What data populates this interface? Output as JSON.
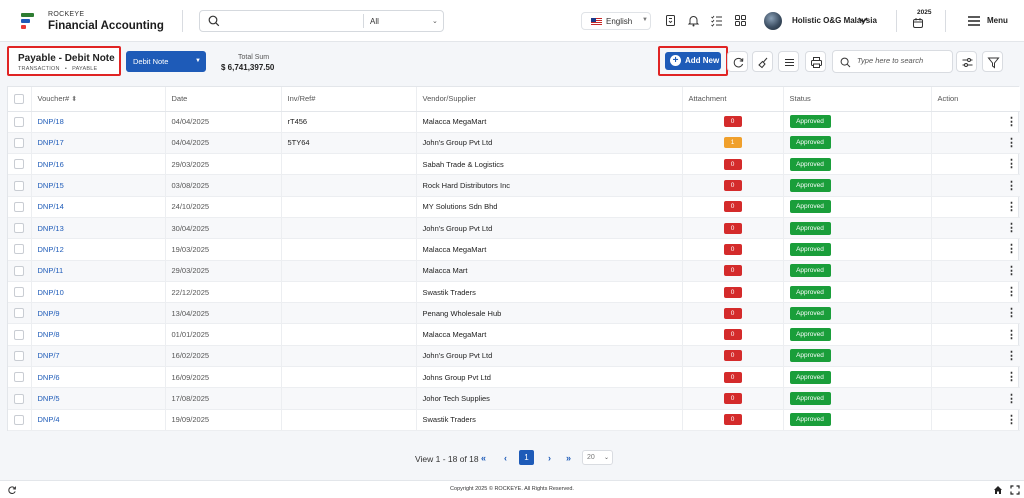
{
  "brand": {
    "small": "ROCKEYE",
    "name": "Financial Accounting"
  },
  "search": {
    "placeholder": "",
    "scope": "All"
  },
  "language": {
    "label": "English"
  },
  "user": {
    "company": "Holistic O&G Malaysia",
    "year": "2025"
  },
  "menu": {
    "label": "Menu"
  },
  "page": {
    "title": "Payable - Debit Note",
    "breadcrumb": [
      "TRANSACTION",
      "PAYABLE"
    ],
    "doc_type": "Debit Note",
    "total_label": "Total Sum",
    "total_value": "$ 6,741,397.50",
    "add_label": "Add New",
    "table_search_placeholder": "Type here to search"
  },
  "table": {
    "columns": [
      "Voucher#",
      "Date",
      "Inv/Ref#",
      "Vendor/Supplier",
      "Attachment",
      "Status",
      "Action"
    ],
    "rows": [
      {
        "voucher": "DNP/18",
        "date": "04/04/2025",
        "ref": "rT456",
        "vendor": "Malacca MegaMart",
        "attachment": "0",
        "status": "Approved"
      },
      {
        "voucher": "DNP/17",
        "date": "04/04/2025",
        "ref": "5TY64",
        "vendor": "John's Group Pvt Ltd",
        "attachment": "1",
        "status": "Approved"
      },
      {
        "voucher": "DNP/16",
        "date": "29/03/2025",
        "ref": "",
        "vendor": "Sabah Trade & Logistics",
        "attachment": "0",
        "status": "Approved"
      },
      {
        "voucher": "DNP/15",
        "date": "03/08/2025",
        "ref": "",
        "vendor": "Rock Hard Distributors Inc",
        "attachment": "0",
        "status": "Approved"
      },
      {
        "voucher": "DNP/14",
        "date": "24/10/2025",
        "ref": "",
        "vendor": "MY Solutions Sdn Bhd",
        "attachment": "0",
        "status": "Approved"
      },
      {
        "voucher": "DNP/13",
        "date": "30/04/2025",
        "ref": "",
        "vendor": "John's Group Pvt Ltd",
        "attachment": "0",
        "status": "Approved"
      },
      {
        "voucher": "DNP/12",
        "date": "19/03/2025",
        "ref": "",
        "vendor": "Malacca MegaMart",
        "attachment": "0",
        "status": "Approved"
      },
      {
        "voucher": "DNP/11",
        "date": "29/03/2025",
        "ref": "",
        "vendor": "Malacca Mart",
        "attachment": "0",
        "status": "Approved"
      },
      {
        "voucher": "DNP/10",
        "date": "22/12/2025",
        "ref": "",
        "vendor": "Swastik Traders",
        "attachment": "0",
        "status": "Approved"
      },
      {
        "voucher": "DNP/9",
        "date": "13/04/2025",
        "ref": "",
        "vendor": "Penang Wholesale Hub",
        "attachment": "0",
        "status": "Approved"
      },
      {
        "voucher": "DNP/8",
        "date": "01/01/2025",
        "ref": "",
        "vendor": "Malacca MegaMart",
        "attachment": "0",
        "status": "Approved"
      },
      {
        "voucher": "DNP/7",
        "date": "16/02/2025",
        "ref": "",
        "vendor": "John's Group Pvt Ltd",
        "attachment": "0",
        "status": "Approved"
      },
      {
        "voucher": "DNP/6",
        "date": "16/09/2025",
        "ref": "",
        "vendor": "Johns Group Pvt Ltd",
        "attachment": "0",
        "status": "Approved"
      },
      {
        "voucher": "DNP/5",
        "date": "17/08/2025",
        "ref": "",
        "vendor": "Johor Tech Supplies",
        "attachment": "0",
        "status": "Approved"
      },
      {
        "voucher": "DNP/4",
        "date": "19/09/2025",
        "ref": "",
        "vendor": "Swastik Traders",
        "attachment": "0",
        "status": "Approved"
      }
    ]
  },
  "pagination": {
    "view_text": "View 1 - 18 of 18",
    "current_page": "1",
    "page_size": "20"
  },
  "footer": {
    "copyright": "Copyright 2025 © ROCKEYE. All Rights Reserved."
  },
  "colors": {
    "primary": "#1e5bb8",
    "highlight": "#e02424",
    "approved": "#1a9e3a",
    "attachment_zero": "#d42b2b",
    "attachment_nonzero": "#f0a02c"
  }
}
